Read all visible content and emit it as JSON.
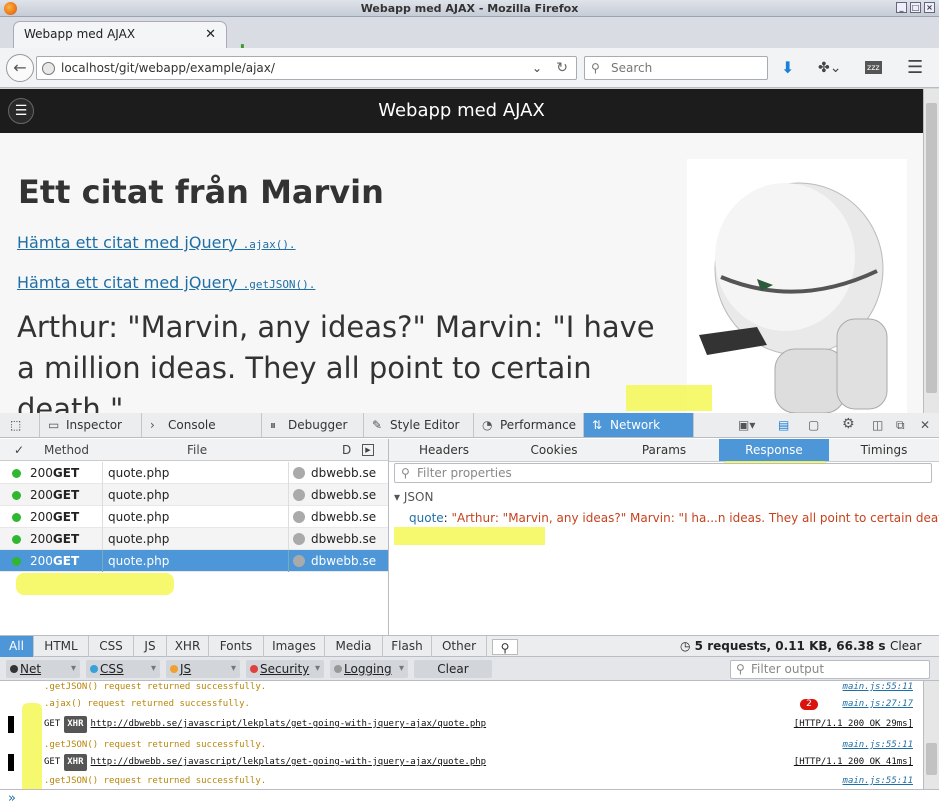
{
  "window": {
    "title": "Webapp med AJAX - Mozilla Firefox"
  },
  "tab": {
    "title": "Webapp med AJAX"
  },
  "nav": {
    "url": "localhost/git/webapp/example/ajax/",
    "search_placeholder": "Search"
  },
  "page": {
    "header": "Webapp med AJAX",
    "heading": "Ett citat från Marvin",
    "link1_text": "Hämta ett citat med jQuery",
    "link1_code": ".ajax().",
    "link2_text": "Hämta ett citat med jQuery",
    "link2_code": ".getJSON().",
    "quote": "Arthur: \"Marvin, any ideas?\" Marvin: \"I have a million ideas. They all point to certain death.\""
  },
  "devtools": {
    "tabs": [
      "Inspector",
      "Console",
      "Debugger",
      "Style Editor",
      "Performance",
      "Network"
    ],
    "active_tab": "Network",
    "columns": {
      "check": "✓",
      "method": "Method",
      "file": "File",
      "domain": "D"
    },
    "requests": [
      {
        "status": "200",
        "method": "GET",
        "file": "quote.php",
        "domain": "dbwebb.se"
      },
      {
        "status": "200",
        "method": "GET",
        "file": "quote.php",
        "domain": "dbwebb.se"
      },
      {
        "status": "200",
        "method": "GET",
        "file": "quote.php",
        "domain": "dbwebb.se"
      },
      {
        "status": "200",
        "method": "GET",
        "file": "quote.php",
        "domain": "dbwebb.se"
      },
      {
        "status": "200",
        "method": "GET",
        "file": "quote.php",
        "domain": "dbwebb.se"
      }
    ],
    "subtabs": [
      "Headers",
      "Cookies",
      "Params",
      "Response",
      "Timings"
    ],
    "active_subtab": "Response",
    "filter_props_placeholder": "Filter properties",
    "json_label": "JSON",
    "json_key": "quote",
    "json_value": "\"Arthur: \"Marvin, any ideas?\" Marvin: \"I ha...n ideas. They all point to certain death.\"\"",
    "filters": [
      "All",
      "HTML",
      "CSS",
      "JS",
      "XHR",
      "Fonts",
      "Images",
      "Media",
      "Flash",
      "Other"
    ],
    "summary": "5 requests, 0.11 KB, 66.38 s",
    "clear": "Clear"
  },
  "console": {
    "filters": [
      {
        "label": "Net",
        "color": "#333333"
      },
      {
        "label": "CSS",
        "color": "#3aa0d8"
      },
      {
        "label": "JS",
        "color": "#f0a030"
      },
      {
        "label": "Security",
        "color": "#e04040"
      },
      {
        "label": "Logging",
        "color": "#999999"
      }
    ],
    "clear": "Clear",
    "filter_output_placeholder": "Filter output",
    "lines": [
      {
        "type": "msg",
        "text": ".getJSON() request returned successfully.",
        "src": "main.js:55:11"
      },
      {
        "type": "msg",
        "text": ".ajax() request returned successfully.",
        "src": "main.js:27:17",
        "badge": "2"
      },
      {
        "type": "net",
        "method": "GET",
        "tag": "XHR",
        "url": "http://dbwebb.se/javascript/lekplats/get-going-with-jquery-ajax/quote.php",
        "status": "[HTTP/1.1 200 OK 29ms]"
      },
      {
        "type": "msg",
        "text": ".getJSON() request returned successfully.",
        "src": "main.js:55:11"
      },
      {
        "type": "net",
        "method": "GET",
        "tag": "XHR",
        "url": "http://dbwebb.se/javascript/lekplats/get-going-with-jquery-ajax/quote.php",
        "status": "[HTTP/1.1 200 OK 41ms]"
      },
      {
        "type": "msg",
        "text": ".getJSON() request returned successfully.",
        "src": "main.js:55:11"
      }
    ],
    "prompt": "»"
  }
}
